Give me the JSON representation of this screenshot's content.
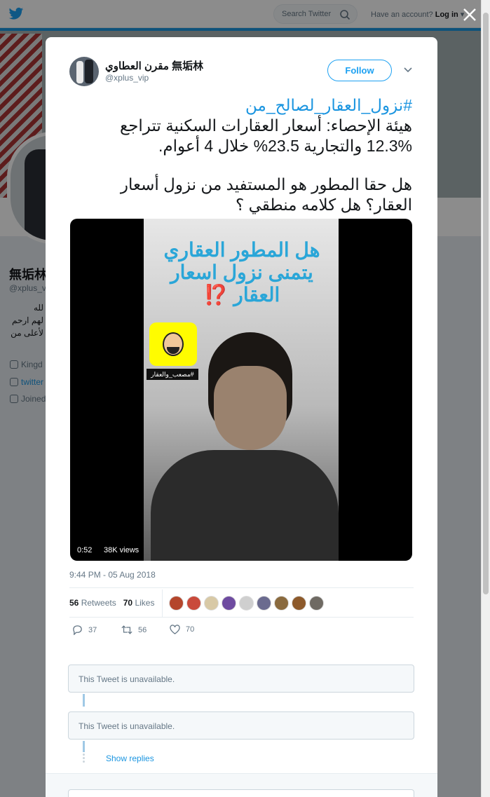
{
  "topbar": {
    "search_placeholder": "Search Twitter",
    "account_prompt": "Have an account?",
    "login_label": "Log in"
  },
  "background_profile": {
    "name": "無垢林",
    "handle": "@xplus_v",
    "bio_lines": [
      "لله",
      "لهم ارحم",
      "لأعلى من"
    ],
    "location": "Kingd",
    "website": "twitter",
    "joined": "Joined"
  },
  "tweet": {
    "author_name": "مقرن العطاوي 無垢林",
    "author_handle": "@xplus_vip",
    "follow_label": "Follow",
    "hashtag": "#نزول_العقار_لصالح_من",
    "line1": "هيئة الإحصاء: أسعار العقارات السكنية تتراجع",
    "line2": "12.3% والتجارية 23.5% خلال 4 أعوام.",
    "line3": "هل حقا المطور هو المستفيد من نزول أسعار",
    "line4": "العقار؟ هل كلامه منطقي ؟",
    "video": {
      "overlay_line1": "هل المطور العقاري",
      "overlay_line2": "يتمنى نزول اسعار",
      "overlay_line3": "العقار",
      "overlay_marks": "⁉️",
      "snap_tag": "#مصعب_والعقار",
      "duration": "0:52",
      "views": "38K views"
    },
    "timestamp": "9:44 PM - 05 Aug 2018",
    "retweets_count": "56",
    "retweets_label": "Retweets",
    "likes_count": "70",
    "likes_label": "Likes",
    "likers": [
      "#b4462c",
      "#c94a3b",
      "#d8c9a6",
      "#6e4ba0",
      "#cfcfcf",
      "#6b6b8f",
      "#8a6a3e",
      "#8d5a2b",
      "#6f6a63"
    ],
    "reply_count": "37",
    "retweet_action_count": "56",
    "like_action_count": "70"
  },
  "thread": {
    "reply1": "This Tweet is unavailable.",
    "reply2": "This Tweet is unavailable.",
    "show_replies": "Show replies"
  }
}
